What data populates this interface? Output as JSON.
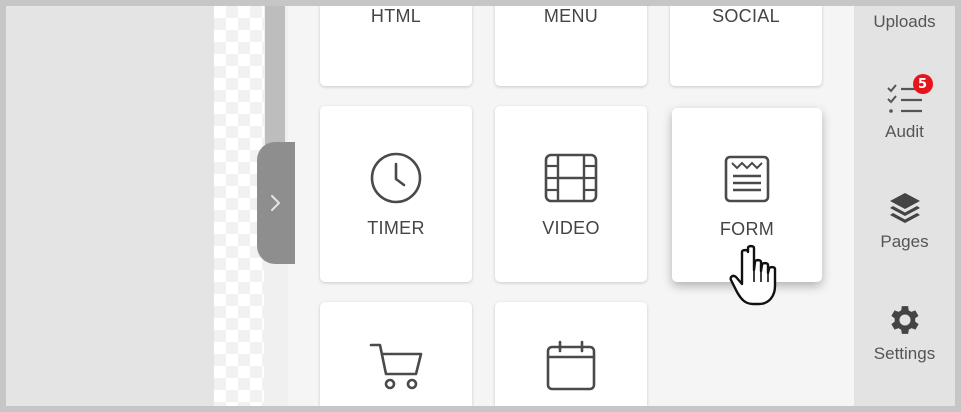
{
  "panel": {
    "tiles_row1": [
      {
        "label": "HTML"
      },
      {
        "label": "MENU"
      },
      {
        "label": "SOCIAL"
      }
    ],
    "tiles_row2": [
      {
        "label": "TIMER",
        "icon": "clock-icon"
      },
      {
        "label": "VIDEO",
        "icon": "film-icon"
      },
      {
        "label": "FORM",
        "icon": "form-icon"
      }
    ],
    "tiles_row3": [
      {
        "label": "",
        "icon": "cart-icon"
      },
      {
        "label": "",
        "icon": "calendar-icon"
      }
    ]
  },
  "rightbar": {
    "uploads_label": "Uploads",
    "audit_label": "Audit",
    "audit_badge": "5",
    "pages_label": "Pages",
    "settings_label": "Settings"
  },
  "colors": {
    "badge": "#e8141b",
    "sidebar_bg": "#e3e3e3",
    "tile_text": "#444444"
  }
}
